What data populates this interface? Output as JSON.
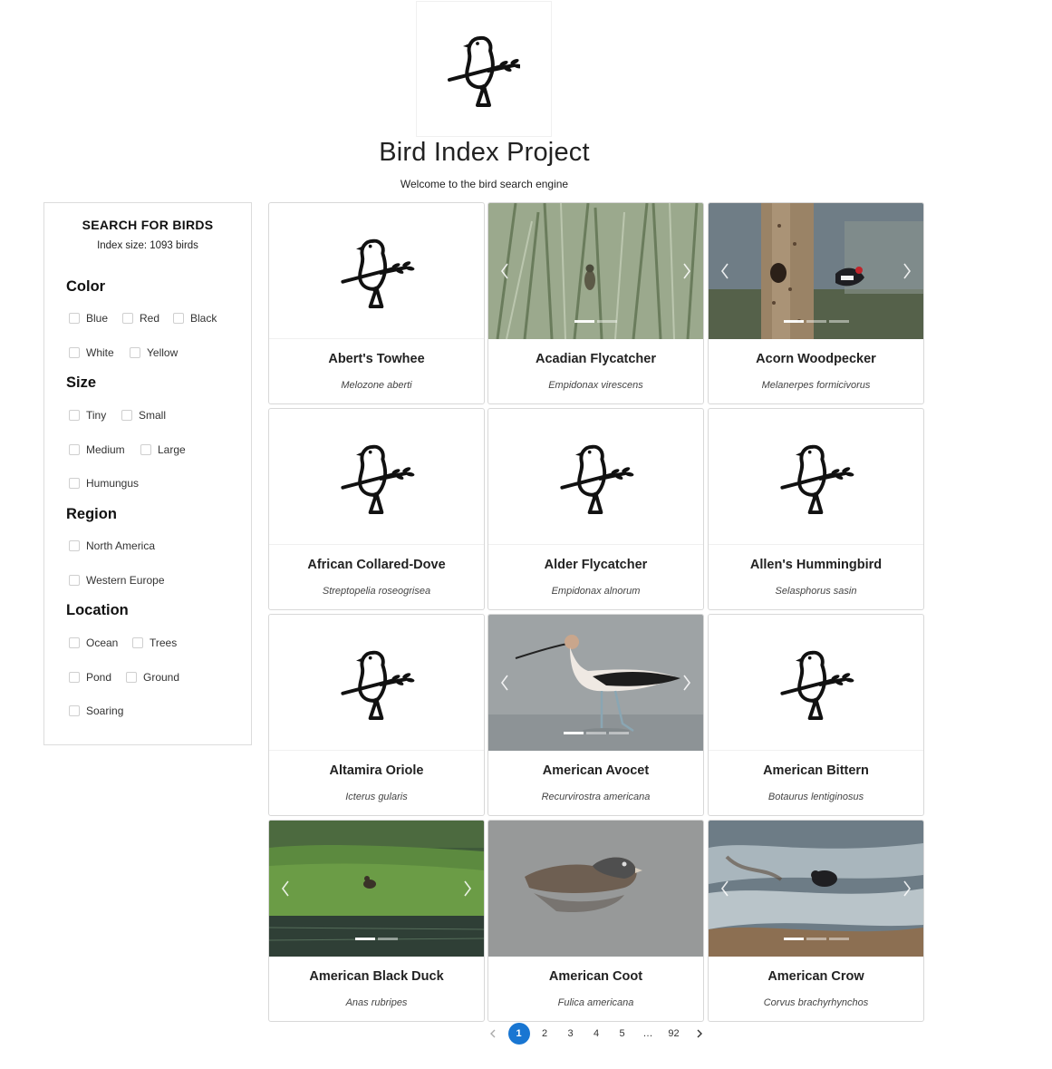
{
  "header": {
    "logo_icon": "bird-logo-icon",
    "title": "Bird Index Project",
    "subtitle": "Welcome to the bird search engine"
  },
  "sidebar": {
    "title": "SEARCH FOR BIRDS",
    "index_size": "Index size: 1093 birds",
    "sections": {
      "color": {
        "title": "Color",
        "options": [
          "Blue",
          "Red",
          "Black",
          "White",
          "Yellow"
        ]
      },
      "size": {
        "title": "Size",
        "options": [
          "Tiny",
          "Small",
          "Medium",
          "Large",
          "Humungus"
        ]
      },
      "region": {
        "title": "Region",
        "options": [
          "North America",
          "Western Europe"
        ]
      },
      "location": {
        "title": "Location",
        "options": [
          "Ocean",
          "Trees",
          "Pond",
          "Ground",
          "Soaring"
        ]
      }
    }
  },
  "cards": [
    {
      "name": "Abert's Towhee",
      "scientific": "Melozone aberti",
      "image": "placeholder-bird-icon"
    },
    {
      "name": "Acadian Flycatcher",
      "scientific": "Empidonax virescens",
      "image": "photo-bird-in-reeds"
    },
    {
      "name": "Acorn Woodpecker",
      "scientific": "Melanerpes formicivorus",
      "image": "photo-woodpecker-on-tree"
    },
    {
      "name": "African Collared-Dove",
      "scientific": "Streptopelia roseogrisea",
      "image": "placeholder-bird-icon"
    },
    {
      "name": "Alder Flycatcher",
      "scientific": "Empidonax alnorum",
      "image": "placeholder-bird-icon"
    },
    {
      "name": "Allen's Hummingbird",
      "scientific": "Selasphorus sasin",
      "image": "placeholder-bird-icon"
    },
    {
      "name": "Altamira Oriole",
      "scientific": "Icterus gularis",
      "image": "placeholder-bird-icon"
    },
    {
      "name": "American Avocet",
      "scientific": "Recurvirostra americana",
      "image": "photo-avocet-wading"
    },
    {
      "name": "American Bittern",
      "scientific": "Botaurus lentiginosus",
      "image": "placeholder-bird-icon"
    },
    {
      "name": "American Black Duck",
      "scientific": "Anas rubripes",
      "image": "photo-duck-on-grassy-shore"
    },
    {
      "name": "American Coot",
      "scientific": "Fulica americana",
      "image": "photo-grebe-on-water"
    },
    {
      "name": "American Crow",
      "scientific": "Corvus brachyrhynchos",
      "image": "photo-crow-on-rocks"
    }
  ],
  "carousel": {
    "prev_icon": "chevron-left-icon",
    "next_icon": "chevron-right-icon"
  },
  "pagination": {
    "prev_icon": "chevron-left-icon",
    "next_icon": "chevron-right-icon",
    "pages": [
      "1",
      "2",
      "3",
      "4",
      "5",
      "…",
      "92"
    ],
    "current": "1"
  },
  "colors": {
    "accent": "#1976d2",
    "border": "#d8d8d8",
    "text": "#222222"
  }
}
